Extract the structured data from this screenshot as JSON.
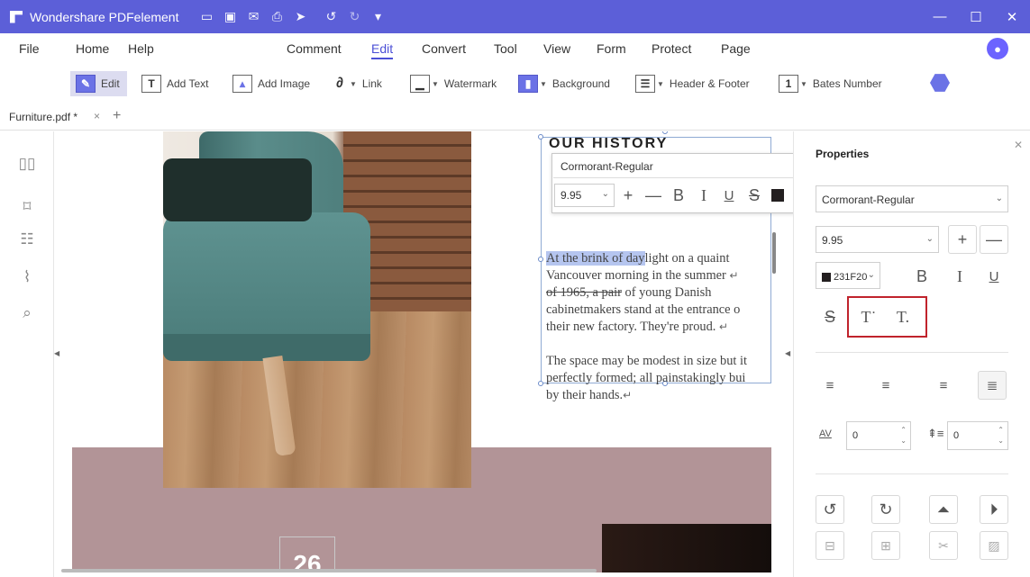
{
  "app": {
    "title": "Wondershare PDFelement",
    "quick_icons": [
      "folder-icon",
      "save-icon",
      "mail-icon",
      "print-icon",
      "share-icon",
      "undo-icon",
      "redo-icon",
      "customize-icon"
    ]
  },
  "window_controls": {
    "minimize": "—",
    "maximize": "☐",
    "close": "✕"
  },
  "menu": {
    "file": "File",
    "home": "Home",
    "help": "Help",
    "comment": "Comment",
    "edit": "Edit",
    "convert": "Convert",
    "tool": "Tool",
    "view": "View",
    "form": "Form",
    "protect": "Protect",
    "page": "Page",
    "active": "Edit"
  },
  "toolbar": {
    "edit": "Edit",
    "add_text": "Add Text",
    "add_image": "Add Image",
    "link": "Link",
    "watermark": "Watermark",
    "background": "Background",
    "header_footer": "Header & Footer",
    "bates_number": "Bates Number"
  },
  "tab": {
    "name": "Furniture.pdf *",
    "close": "×",
    "add": "+"
  },
  "document": {
    "heading_fragment": "OUR HISTORY",
    "para1_highlight": "At the brink of day",
    "para1_l1_rest": "light on a quaint",
    "para1_l2": "Vancouver morning in the summer",
    "para1_l3_strike": "of 1965, a pair",
    "para1_l3_rest": " of young Danish",
    "para1_l4": "cabinetmakers stand at the entrance o",
    "para1_l5": "their new factory. They're proud.",
    "para2_l1": "The space may be modest in size but it",
    "para2_l2": "perfectly formed; all painstakingly bui",
    "para2_l3": "by their hands.",
    "return_mark": "↵",
    "page_number": "26"
  },
  "font_toolbar": {
    "font": "Cormorant-Regular",
    "size": "9.95",
    "plus": "+",
    "minus": "—",
    "bold": "B",
    "italic": "I",
    "underline": "U",
    "strike": "S"
  },
  "properties": {
    "title": "Properties",
    "font": "Cormorant-Regular",
    "size": "9.95",
    "color_hex": "231F20",
    "bold": "B",
    "italic": "I",
    "underline": "U",
    "strike": "S",
    "superscript": "T˙",
    "subscript": "T.",
    "char_spacing": "0",
    "line_spacing": "0"
  }
}
